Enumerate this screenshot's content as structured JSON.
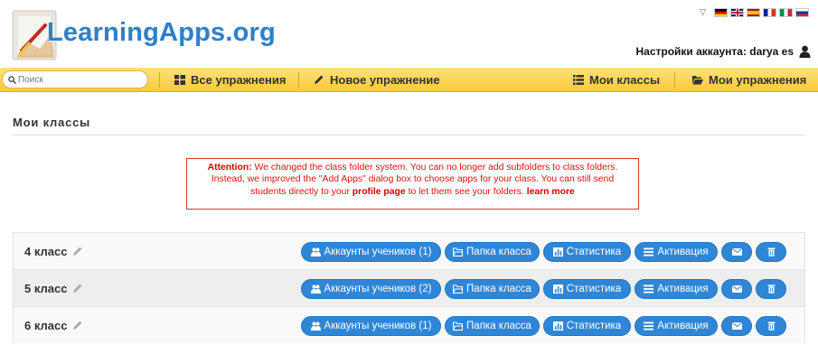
{
  "header": {
    "logo_text": "LearningApps.org",
    "account_label": "Настройки аккаунта: darya es"
  },
  "languages": [
    "de",
    "en",
    "es",
    "fr",
    "it",
    "ru"
  ],
  "search": {
    "placeholder": "Поиск",
    "value": ""
  },
  "nav": {
    "all_exercises": "Все упражнения",
    "new_exercise": "Новое упражнение",
    "my_classes": "Мои классы",
    "my_exercises": "Мои упражнения"
  },
  "page": {
    "title": "Мои классы"
  },
  "notice": {
    "prefix": "Attention:",
    "text1": " We changed the class folder system. You can no longer add subfolders to class folders. Instead, we improved the \"Add Apps\" dialog box to choose apps for your class. You can still send students directly to your ",
    "profile_link": "profile page",
    "text2": " to let them see your folders. ",
    "learn_more": "learn more"
  },
  "classes": [
    {
      "name": "4 класс",
      "accounts": "Аккаунты учеников (1)"
    },
    {
      "name": "5 класс",
      "accounts": "Аккаунты учеников (2)"
    },
    {
      "name": "6 класс",
      "accounts": "Аккаунты учеников (1)"
    }
  ],
  "buttons": {
    "folder": "Папка класса",
    "stats": "Статистика",
    "activate": "Активация"
  },
  "colors": {
    "nav_bg": "#f8c93a",
    "button": "#2f86d6",
    "notice": "#e01010",
    "logo": "#2f7fc8"
  }
}
